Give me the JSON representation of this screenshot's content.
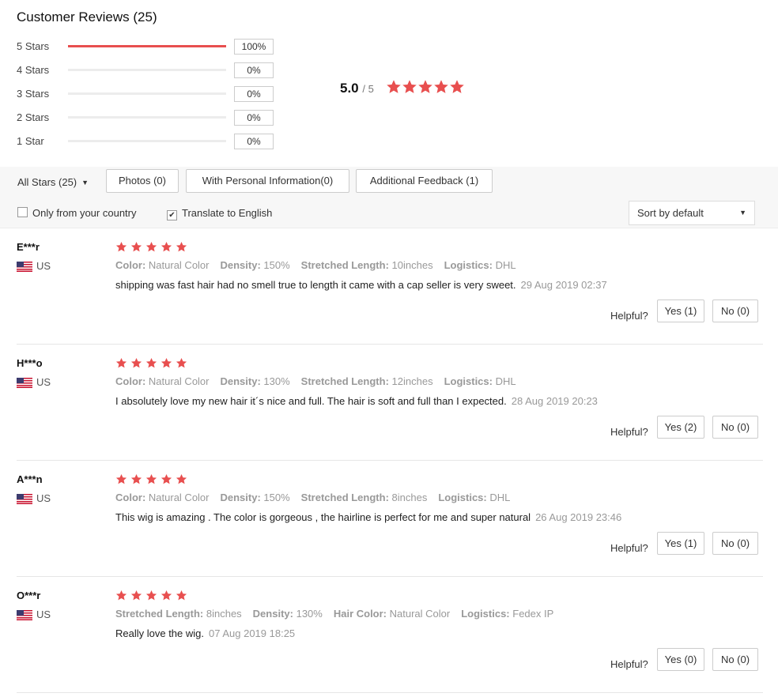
{
  "header": {
    "title": "Customer Reviews (25)"
  },
  "distribution": [
    {
      "label": "5 Stars",
      "percent": "100%",
      "fraction": 1.0
    },
    {
      "label": "4 Stars",
      "percent": "0%",
      "fraction": 0
    },
    {
      "label": "3 Stars",
      "percent": "0%",
      "fraction": 0
    },
    {
      "label": "2 Stars",
      "percent": "0%",
      "fraction": 0
    },
    {
      "label": "1 Star",
      "percent": "0%",
      "fraction": 0
    }
  ],
  "average": {
    "score": "5.0",
    "out_of": "/ 5",
    "stars": 5
  },
  "filters": {
    "all_stars": "All Stars (25)",
    "photos": "Photos (0)",
    "personal_info": "With Personal Information(0)",
    "additional_feedback": "Additional Feedback (1)",
    "only_country": {
      "label": "Only from your country",
      "checked": false
    },
    "translate": {
      "label": "Translate to English",
      "checked": true
    },
    "sort": "Sort by default"
  },
  "colors": {
    "star": "#e84f4f",
    "accent": "#e84f4f"
  },
  "reviews": [
    {
      "user": "E***r",
      "country": "US",
      "stars": 5,
      "attrs": [
        {
          "k": "Color:",
          "v": "Natural Color"
        },
        {
          "k": "Density:",
          "v": "150%"
        },
        {
          "k": "Stretched Length:",
          "v": "10inches"
        },
        {
          "k": "Logistics:",
          "v": "DHL"
        }
      ],
      "text": "shipping was fast hair had no smell true to length it came with a cap seller is very sweet.",
      "date": "29 Aug 2019 02:37",
      "helpful": "Helpful?",
      "yes": "Yes (1)",
      "no": "No (0)"
    },
    {
      "user": "H***o",
      "country": "US",
      "stars": 5,
      "attrs": [
        {
          "k": "Color:",
          "v": "Natural Color"
        },
        {
          "k": "Density:",
          "v": "130%"
        },
        {
          "k": "Stretched Length:",
          "v": "12inches"
        },
        {
          "k": "Logistics:",
          "v": "DHL"
        }
      ],
      "text": "I absolutely love my new hair it´s nice and full. The hair is soft and full than I expected.",
      "date": "28 Aug 2019 20:23",
      "helpful": "Helpful?",
      "yes": "Yes (2)",
      "no": "No (0)"
    },
    {
      "user": "A***n",
      "country": "US",
      "stars": 5,
      "attrs": [
        {
          "k": "Color:",
          "v": "Natural Color"
        },
        {
          "k": "Density:",
          "v": "150%"
        },
        {
          "k": "Stretched Length:",
          "v": "8inches"
        },
        {
          "k": "Logistics:",
          "v": "DHL"
        }
      ],
      "text": "This wig is amazing . The color is gorgeous , the hairline is perfect for me and super natural",
      "date": "26 Aug 2019 23:46",
      "helpful": "Helpful?",
      "yes": "Yes (1)",
      "no": "No (0)"
    },
    {
      "user": "O***r",
      "country": "US",
      "stars": 5,
      "attrs": [
        {
          "k": "Stretched Length:",
          "v": "8inches"
        },
        {
          "k": "Density:",
          "v": "130%"
        },
        {
          "k": "Hair Color:",
          "v": "Natural Color"
        },
        {
          "k": "Logistics:",
          "v": "Fedex IP"
        }
      ],
      "text": "Really love the wig.",
      "date": "07 Aug 2019 18:25",
      "helpful": "Helpful?",
      "yes": "Yes (0)",
      "no": "No (0)"
    }
  ]
}
